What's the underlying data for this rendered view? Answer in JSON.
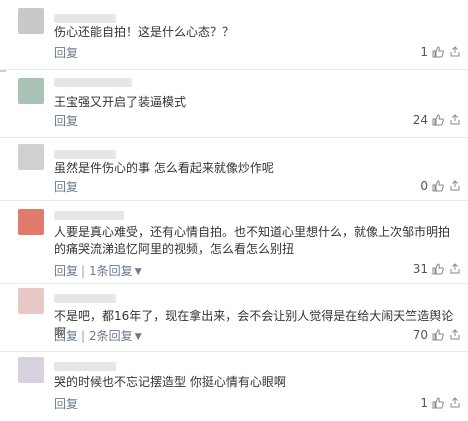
{
  "comments": [
    {
      "text": "伤心还能自拍！这是什么心态？？",
      "reply_label": "回复",
      "likes": "1",
      "avatar_color": "#c9c9c9"
    },
    {
      "text": "王宝强又开启了装逼模式",
      "reply_label": "回复",
      "likes": "24",
      "avatar_color": "#a9c3b6"
    },
    {
      "text": "虽然是件伤心的事 怎么看起来就像炒作呢",
      "reply_label": "回复",
      "likes": "0",
      "avatar_color": "#d0d0d0"
    },
    {
      "text": "人要是真心难受，还有心情自拍。也不知道心里想什么，就像上次邹市明拍的痛哭流涕追忆阿里的视频，怎么看怎么别扭",
      "reply_label": "回复",
      "replies_label": "1条回复",
      "likes": "31",
      "avatar_color": "#e07a6a"
    },
    {
      "text": "不是吧，都16年了，现在拿出来，会不会让别人觉得是在给大闹天竺造舆论啊",
      "reply_label": "回复",
      "replies_label": "2条回复",
      "likes": "70",
      "avatar_color": "#e8c8c4"
    },
    {
      "text": "哭的时候也不忘记摆造型 你挺心情有心眼啊",
      "reply_label": "回复",
      "likes": "1",
      "avatar_color": "#d8d2e0"
    }
  ],
  "colors": {
    "link": "#6a7b8c",
    "text": "#333333",
    "divider": "#ececec"
  },
  "icons": {
    "like": "thumbs-up-icon",
    "more": "share-icon"
  }
}
